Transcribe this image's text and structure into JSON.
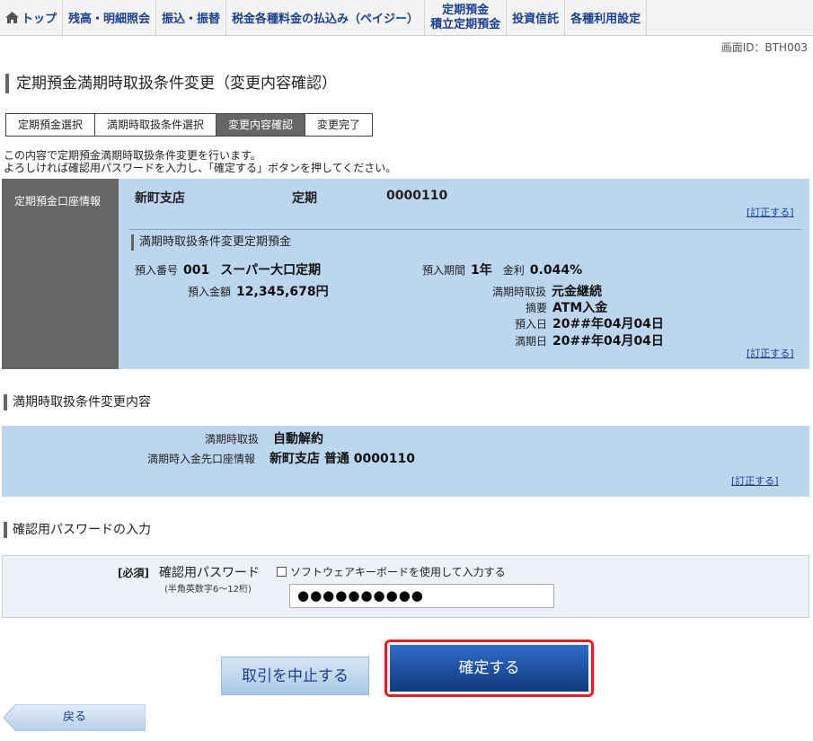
{
  "nav": {
    "home": "トップ",
    "items": [
      "残高・明細照会",
      "振込・振替",
      "税金各種料金の払込み（ペイジー）"
    ],
    "time_deposit_line1": "定期預金",
    "time_deposit_line2": "積立定期預金",
    "items2": [
      "投資信託",
      "各種利用設定"
    ]
  },
  "screen_id": "画面ID：BTH003",
  "page_title": "定期預金満期時取扱条件変更（変更内容確認）",
  "steps": [
    {
      "label": "定期預金選択",
      "active": false
    },
    {
      "label": "満期時取扱条件選択",
      "active": false
    },
    {
      "label": "変更内容確認",
      "active": true
    },
    {
      "label": "変更完了",
      "active": false
    }
  ],
  "intro": {
    "line1": "この内容で定期預金満期時取扱条件変更を行います。",
    "line2": "よろしければ確認用パスワードを入力し、「確定する」ボタンを押してください。"
  },
  "account": {
    "label": "定期預金口座情報",
    "branch": "新町支店",
    "type": "定期",
    "number": "0000110",
    "edit": "[訂正する]",
    "sub_title": "満期時取扱条件変更定期預金",
    "deposit_no_label": "預入番号",
    "deposit_no": "001",
    "product": "スーパー大口定期",
    "period_label": "預入期間",
    "period": "1年",
    "rate_label": "金利",
    "rate": "0.044%",
    "amount_label": "預入金額",
    "amount": "12,345,678円",
    "maturity_label": "満期時取扱",
    "maturity": "元金継続",
    "memo_label": "摘要",
    "memo": "ATM入金",
    "deposit_date_label": "預入日",
    "deposit_date": "20##年04月04日",
    "maturity_date_label": "満期日",
    "maturity_date": "20##年04月04日",
    "edit2": "[訂正する]"
  },
  "change": {
    "title": "満期時取扱条件変更内容",
    "handling_label": "満期時取扱",
    "handling": "自動解約",
    "dest_label": "満期時入金先口座情報",
    "dest": "新町支店 普通 0000110",
    "edit": "[訂正する]"
  },
  "password": {
    "title": "確認用パスワードの入力",
    "required": "[必須]",
    "label": "確認用パスワード",
    "note": "(半角英数字6～12桁)",
    "keyboard_label": "ソフトウェアキーボードを使用して入力する",
    "value": "●●●●●●●●●●"
  },
  "buttons": {
    "cancel": "取引を中止する",
    "confirm": "確定する",
    "back": "戻る"
  },
  "colors": {
    "nav_text": "#1b3f8f",
    "panel_blue": "#bcd6f0",
    "label_gray": "#666666",
    "confirm_highlight": "#e02020"
  }
}
